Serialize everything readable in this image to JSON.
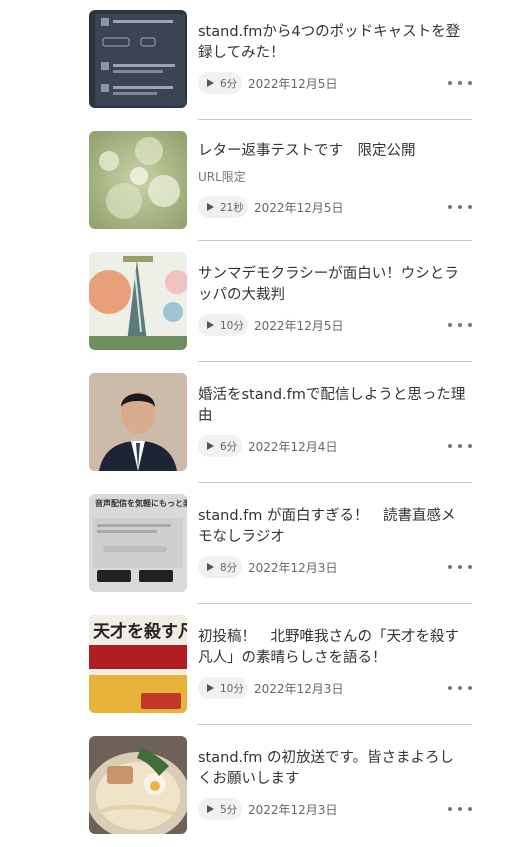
{
  "episodes": [
    {
      "title": "stand.fmから4つのポッドキャストを登録してみた！",
      "sub": "",
      "duration": "6分",
      "date": "2022年12月5日"
    },
    {
      "title": "レター返事テストです　限定公開",
      "sub": "URL限定",
      "duration": "21秒",
      "date": "2022年12月5日"
    },
    {
      "title": "サンマデモクラシーが面白い！ウシとラッパの大裁判",
      "sub": "",
      "duration": "10分",
      "date": "2022年12月5日"
    },
    {
      "title": "婚活をstand.fmで配信しようと思った理由",
      "sub": "",
      "duration": "6分",
      "date": "2022年12月4日"
    },
    {
      "title": "stand.fm が面白すぎる！　読書直感メモなしラジオ",
      "sub": "",
      "duration": "8分",
      "date": "2022年12月3日"
    },
    {
      "title": "初投稿！　北野唯我さんの「天才を殺す凡人」の素晴らしさを語る！",
      "sub": "",
      "duration": "10分",
      "date": "2022年12月3日"
    },
    {
      "title": "stand.fm の初放送です。皆さまよろしくお願いします",
      "sub": "",
      "duration": "5分",
      "date": "2022年12月3日"
    }
  ],
  "thumbnails": {
    "ep5_text": "音声配信を気軽にもっと楽しく",
    "ep6_text": "天才を殺す凡人"
  },
  "icons": {
    "play": "play-icon",
    "more": "more-options-icon"
  },
  "colors": {
    "text": "#333333",
    "muted": "#777777",
    "pill": "#f1f1f1",
    "divider": "#c8c8c8"
  }
}
